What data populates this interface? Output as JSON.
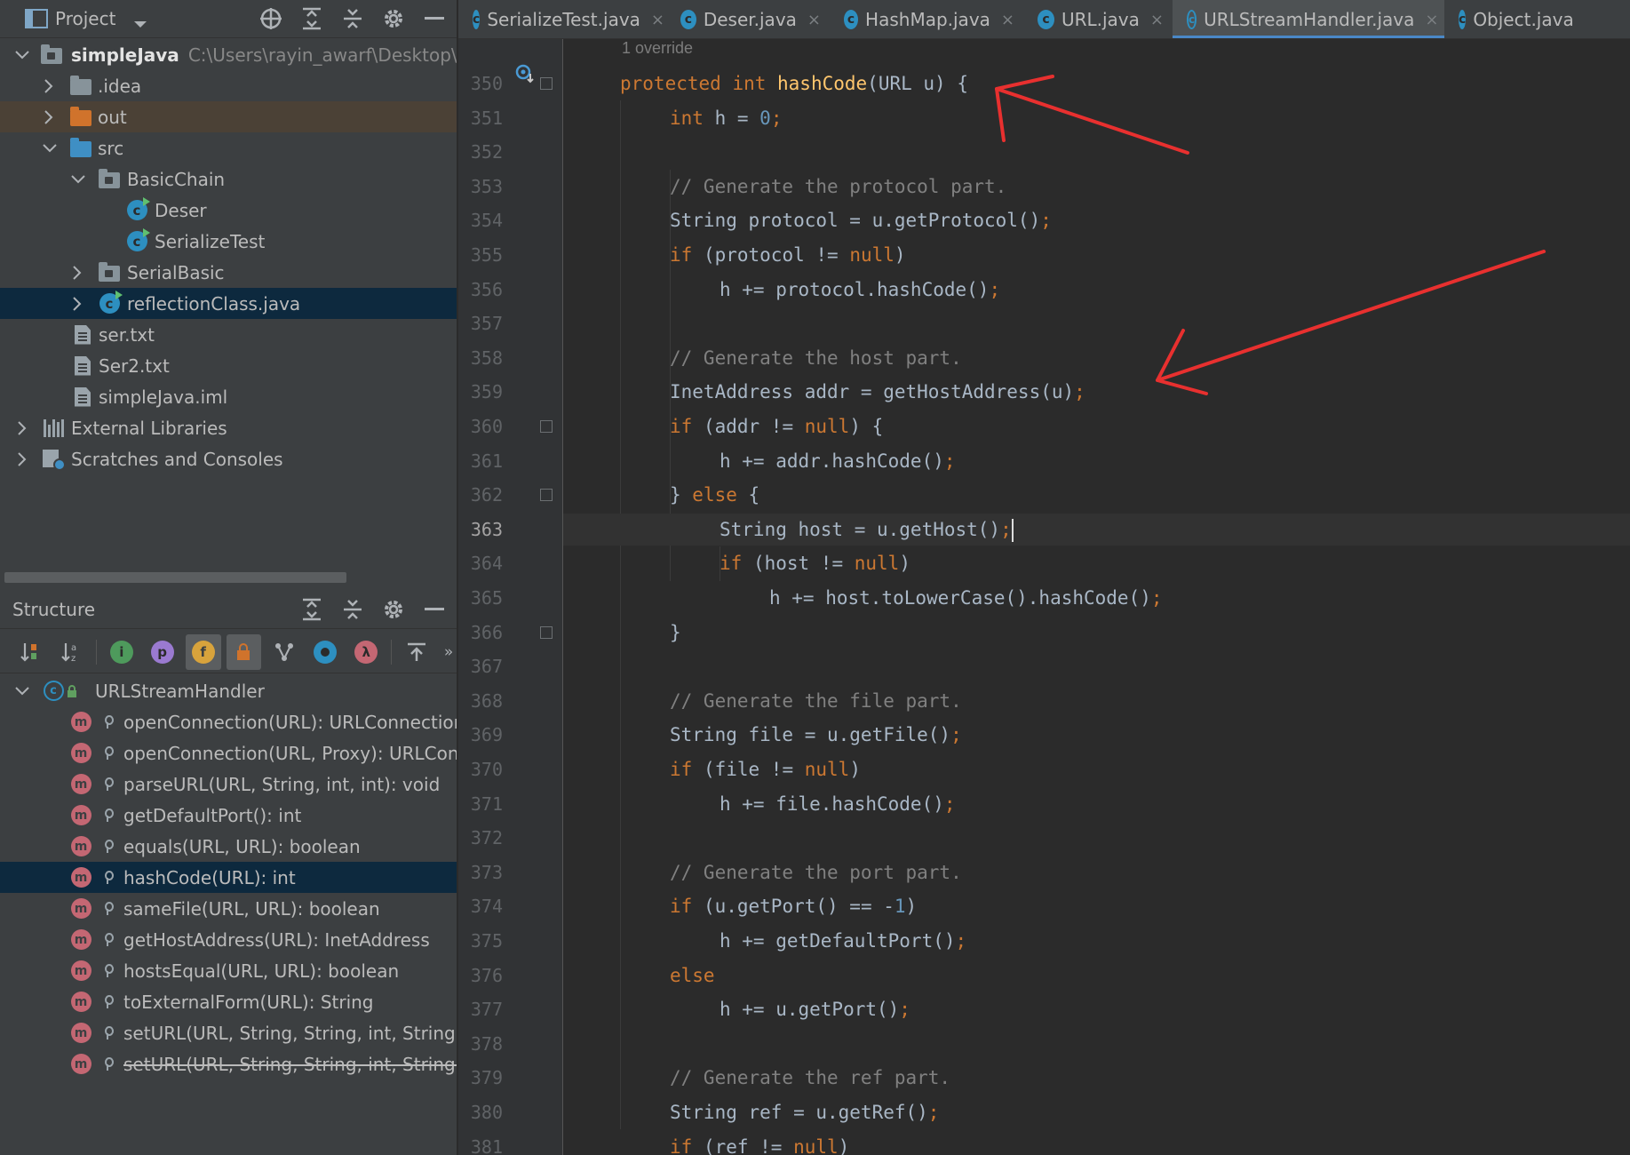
{
  "project_panel": {
    "title": "Project",
    "tools": [
      "locate-icon",
      "expand-all-icon",
      "collapse-all-icon",
      "gear-icon",
      "minimize-icon"
    ],
    "tree": [
      {
        "label": "simpleJava",
        "extra": "C:\\Users\\rayin_awarf\\Desktop\\worl",
        "icon": "module-folder-icon",
        "expanded": true
      },
      {
        "label": ".idea",
        "icon": "folder-icon",
        "expanded": false
      },
      {
        "label": "out",
        "icon": "orange-folder-icon",
        "expanded": false
      },
      {
        "label": "src",
        "icon": "source-folder-icon",
        "expanded": true
      },
      {
        "label": "BasicChain",
        "icon": "package-icon",
        "expanded": true
      },
      {
        "label": "Deser",
        "icon": "class-icon"
      },
      {
        "label": "SerializeTest",
        "icon": "class-icon"
      },
      {
        "label": "SerialBasic",
        "icon": "package-icon",
        "expanded": false
      },
      {
        "label": "reflectionClass.java",
        "icon": "class-icon",
        "expanded": false,
        "selected": true
      },
      {
        "label": "ser.txt",
        "icon": "text-file-icon"
      },
      {
        "label": "Ser2.txt",
        "icon": "text-file-icon"
      },
      {
        "label": "simpleJava.iml",
        "icon": "iml-file-icon"
      },
      {
        "label": "External Libraries",
        "icon": "libraries-icon",
        "expanded": false
      },
      {
        "label": "Scratches and Consoles",
        "icon": "scratches-icon",
        "expanded": false
      }
    ]
  },
  "structure_panel": {
    "title": "Structure",
    "root": {
      "label": "URLStreamHandler",
      "icon": "abstract-class-icon"
    },
    "members": [
      {
        "label": "openConnection(URL): URLConnection"
      },
      {
        "label": "openConnection(URL, Proxy): URLConnec"
      },
      {
        "label": "parseURL(URL, String, int, int): void"
      },
      {
        "label": "getDefaultPort(): int"
      },
      {
        "label": "equals(URL, URL): boolean"
      },
      {
        "label": "hashCode(URL): int",
        "selected": true
      },
      {
        "label": "sameFile(URL, URL): boolean"
      },
      {
        "label": "getHostAddress(URL): InetAddress"
      },
      {
        "label": "hostsEqual(URL, URL): boolean"
      },
      {
        "label": "toExternalForm(URL): String"
      },
      {
        "label": "setURL(URL, String, String, int, String, Stri"
      },
      {
        "label": "setURL(URL, String, String, int, String, Stri",
        "deprecated": true
      }
    ],
    "toolbar": {
      "badge_i": "i",
      "badge_p": "p",
      "badge_f": "f",
      "badge_lambda": "λ",
      "more": "»"
    }
  },
  "editor": {
    "tabs": [
      {
        "label": "SerializeTest.java"
      },
      {
        "label": "Deser.java"
      },
      {
        "label": "HashMap.java"
      },
      {
        "label": "URL.java"
      },
      {
        "label": "URLStreamHandler.java",
        "active": true
      },
      {
        "label": "Object.java"
      }
    ],
    "inlay_hint": "1 override",
    "current_line": 363,
    "lines": [
      {
        "n": 350,
        "indent": 0,
        "parts": [
          [
            "kw",
            "protected "
          ],
          [
            "kw",
            "int "
          ],
          [
            "fn",
            "hashCode"
          ],
          [
            "p",
            "(URL u) {"
          ]
        ]
      },
      {
        "n": 351,
        "indent": 1,
        "parts": [
          [
            "kw",
            "int "
          ],
          [
            "p",
            "h = "
          ],
          [
            "num",
            "0"
          ],
          [
            "kw",
            ";"
          ]
        ]
      },
      {
        "n": 352,
        "indent": 0,
        "parts": []
      },
      {
        "n": 353,
        "indent": 1,
        "parts": [
          [
            "cm",
            "// Generate the protocol part."
          ]
        ]
      },
      {
        "n": 354,
        "indent": 1,
        "parts": [
          [
            "p",
            "String protocol = u.getProtocol()"
          ],
          [
            "kw",
            ";"
          ]
        ]
      },
      {
        "n": 355,
        "indent": 1,
        "parts": [
          [
            "kw",
            "if "
          ],
          [
            "p",
            "(protocol != "
          ],
          [
            "kw",
            "null"
          ],
          [
            "p",
            ")"
          ]
        ]
      },
      {
        "n": 356,
        "indent": 2,
        "parts": [
          [
            "p",
            "h += protocol.hashCode()"
          ],
          [
            "kw",
            ";"
          ]
        ]
      },
      {
        "n": 357,
        "indent": 0,
        "parts": []
      },
      {
        "n": 358,
        "indent": 1,
        "parts": [
          [
            "cm",
            "// Generate the host part."
          ]
        ]
      },
      {
        "n": 359,
        "indent": 1,
        "parts": [
          [
            "p",
            "InetAddress addr = getHostAddress(u)"
          ],
          [
            "kw",
            ";"
          ]
        ]
      },
      {
        "n": 360,
        "indent": 1,
        "parts": [
          [
            "kw",
            "if "
          ],
          [
            "p",
            "(addr != "
          ],
          [
            "kw",
            "null"
          ],
          [
            "p",
            ") {"
          ]
        ]
      },
      {
        "n": 361,
        "indent": 2,
        "parts": [
          [
            "p",
            "h += addr.hashCode()"
          ],
          [
            "kw",
            ";"
          ]
        ]
      },
      {
        "n": 362,
        "indent": 1,
        "parts": [
          [
            "p",
            "} "
          ],
          [
            "kw",
            "else "
          ],
          [
            "p",
            "{"
          ]
        ]
      },
      {
        "n": 363,
        "indent": 2,
        "parts": [
          [
            "p",
            "String host = u.getHost()"
          ],
          [
            "kw",
            ";"
          ]
        ]
      },
      {
        "n": 364,
        "indent": 2,
        "parts": [
          [
            "kw",
            "if "
          ],
          [
            "p",
            "(host != "
          ],
          [
            "kw",
            "null"
          ],
          [
            "p",
            ")"
          ]
        ]
      },
      {
        "n": 365,
        "indent": 3,
        "parts": [
          [
            "p",
            "h += host.toLowerCase().hashCode()"
          ],
          [
            "kw",
            ";"
          ]
        ]
      },
      {
        "n": 366,
        "indent": 1,
        "parts": [
          [
            "p",
            "}"
          ]
        ]
      },
      {
        "n": 367,
        "indent": 0,
        "parts": []
      },
      {
        "n": 368,
        "indent": 1,
        "parts": [
          [
            "cm",
            "// Generate the file part."
          ]
        ]
      },
      {
        "n": 369,
        "indent": 1,
        "parts": [
          [
            "p",
            "String file = u.getFile()"
          ],
          [
            "kw",
            ";"
          ]
        ]
      },
      {
        "n": 370,
        "indent": 1,
        "parts": [
          [
            "kw",
            "if "
          ],
          [
            "p",
            "(file != "
          ],
          [
            "kw",
            "null"
          ],
          [
            "p",
            ")"
          ]
        ]
      },
      {
        "n": 371,
        "indent": 2,
        "parts": [
          [
            "p",
            "h += file.hashCode()"
          ],
          [
            "kw",
            ";"
          ]
        ]
      },
      {
        "n": 372,
        "indent": 0,
        "parts": []
      },
      {
        "n": 373,
        "indent": 1,
        "parts": [
          [
            "cm",
            "// Generate the port part."
          ]
        ]
      },
      {
        "n": 374,
        "indent": 1,
        "parts": [
          [
            "kw",
            "if "
          ],
          [
            "p",
            "(u.getPort() == -"
          ],
          [
            "num",
            "1"
          ],
          [
            "p",
            ")"
          ]
        ]
      },
      {
        "n": 375,
        "indent": 2,
        "parts": [
          [
            "p",
            "h += getDefaultPort()"
          ],
          [
            "kw",
            ";"
          ]
        ]
      },
      {
        "n": 376,
        "indent": 1,
        "parts": [
          [
            "kw",
            "else"
          ]
        ]
      },
      {
        "n": 377,
        "indent": 2,
        "parts": [
          [
            "p",
            "h += u.getPort()"
          ],
          [
            "kw",
            ";"
          ]
        ]
      },
      {
        "n": 378,
        "indent": 0,
        "parts": []
      },
      {
        "n": 379,
        "indent": 1,
        "parts": [
          [
            "cm",
            "// Generate the ref part."
          ]
        ]
      },
      {
        "n": 380,
        "indent": 1,
        "parts": [
          [
            "p",
            "String ref = u.getRef()"
          ],
          [
            "kw",
            ";"
          ]
        ]
      },
      {
        "n": 381,
        "indent": 1,
        "parts": [
          [
            "kw",
            "if "
          ],
          [
            "p",
            "(ref != "
          ],
          [
            "kw",
            "null"
          ],
          [
            "p",
            ")"
          ]
        ]
      }
    ]
  },
  "annotations": {
    "arrow_color": "#e8302f",
    "arrows": [
      "arrow-to-hashcode-signature",
      "arrow-to-gethostaddress-call"
    ]
  },
  "colors": {
    "keyword": "#cc7832",
    "method_declaration": "#ffc66d",
    "comment": "#808080",
    "number": "#6897bb",
    "text": "#a9b7c6",
    "selection": "#0d293e",
    "active_tab_underline": "#4a88c7"
  }
}
